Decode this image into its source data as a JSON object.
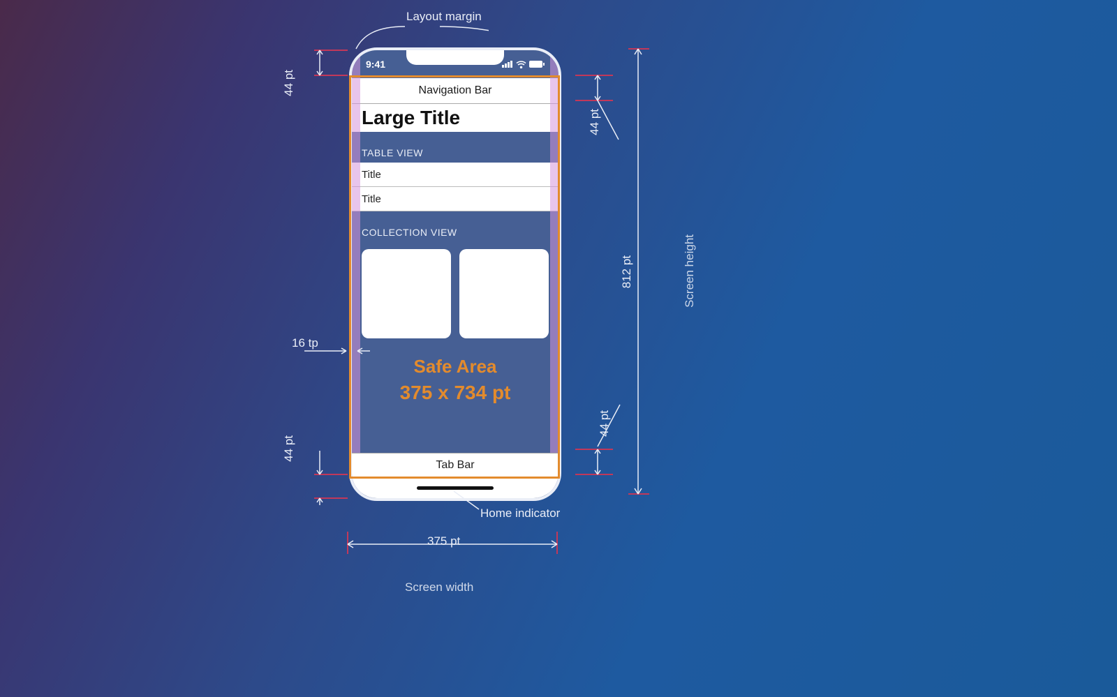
{
  "annotations": {
    "layout_margin": "Layout margin",
    "home_indicator": "Home indicator",
    "screen_width_label": "Screen width",
    "screen_height_label": "Screen height",
    "status_inset": "44 pt",
    "navbar_height": "44 pt",
    "tabbar_height": "44 pt",
    "home_indicator_height": "44 pt",
    "side_margin": "16 tp",
    "width_value": "375 pt",
    "height_value": "812 pt"
  },
  "phone": {
    "status_time": "9:41",
    "nav_bar": "Navigation Bar",
    "large_title": "Large Title",
    "table_header": "TABLE VIEW",
    "row1": "Title",
    "row2": "Title",
    "collection_header": "COLLECTION VIEW",
    "safe_area_line1": "Safe Area",
    "safe_area_line2": "375 x 734 pt",
    "tab_bar": "Tab Bar"
  },
  "icons": {
    "signal": "signal-icon",
    "wifi": "wifi-icon",
    "battery": "battery-icon"
  }
}
